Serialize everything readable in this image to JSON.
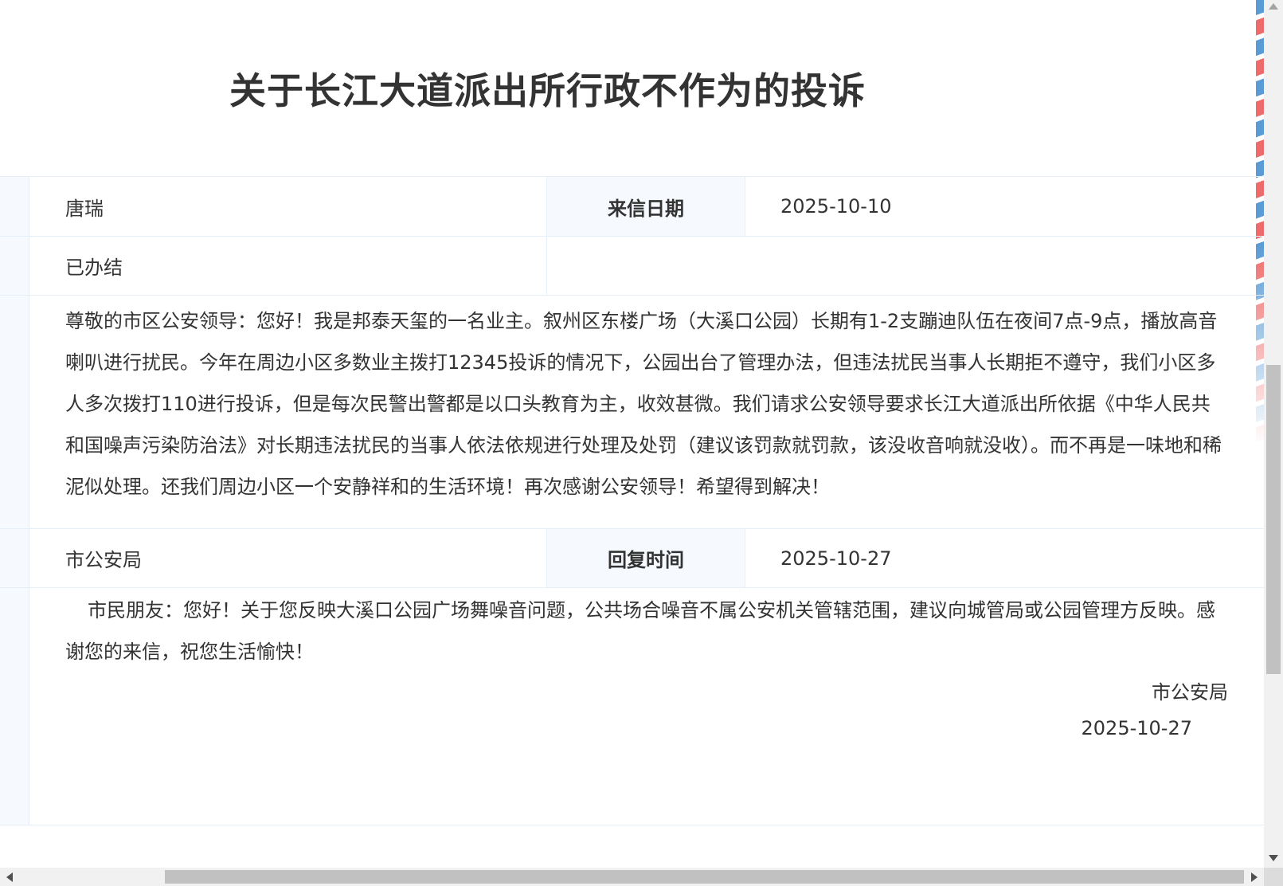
{
  "page": {
    "title": "关于长江大道派出所行政不作为的投诉"
  },
  "letter": {
    "sender": "唐瑞",
    "date_label": "来信日期",
    "date": "2025-10-10",
    "status": "已办结",
    "content": "尊敬的市区公安领导：您好！我是邦泰天玺的一名业主。叙州区东楼广场（大溪口公园）长期有1-2支蹦迪队伍在夜间7点-9点，播放高音喇叭进行扰民。今年在周边小区多数业主拨打12345投诉的情况下，公园出台了管理办法，但违法扰民当事人长期拒不遵守，我们小区多人多次拨打110进行投诉，但是每次民警出警都是以口头教育为主，收效甚微。我们请求公安领导要求长江大道派出所依据《中华人民共和国噪声污染防治法》对长期违法扰民的当事人依法依规进行处理及处罚（建议该罚款就罚款，该没收音响就没收）。而不再是一味地和稀泥似处理。还我们周边小区一个安静祥和的生活环境！再次感谢公安领导！希望得到解决！"
  },
  "reply": {
    "department": "市公安局",
    "time_label": "回复时间",
    "time": "2025-10-27",
    "content": "市民朋友：您好！关于您反映大溪口公园广场舞噪音问题，公共场合噪音不属公安机关管辖范围，建议向城管局或公园管理方反映。感谢您的来信，祝您生活愉快！",
    "signature": "市公安局",
    "signature_date": "2025-10-27"
  },
  "colors": {
    "label_bg": "#f6fafe",
    "border": "#e6eef7",
    "text": "#333333",
    "airmail_blue": "#5b9bd5",
    "airmail_red": "#ee6b6b"
  }
}
